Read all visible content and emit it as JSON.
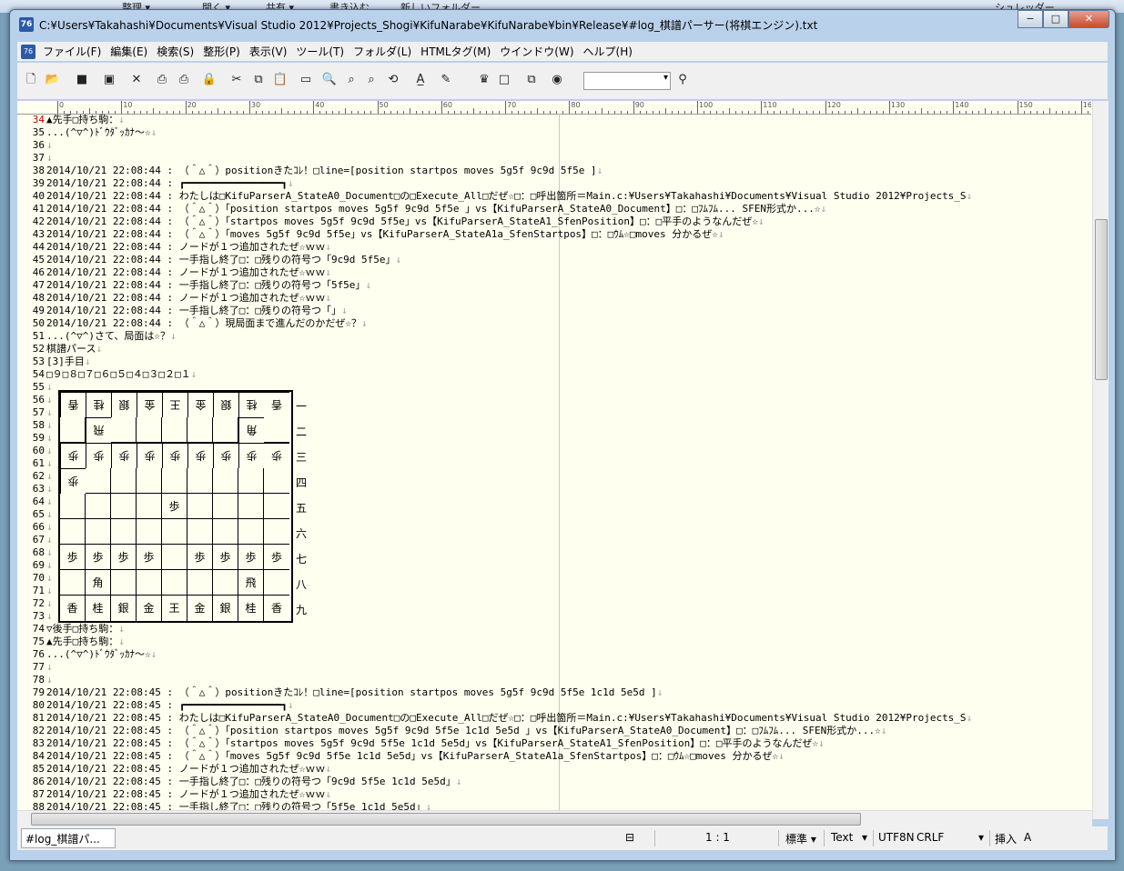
{
  "explorer": {
    "organize": "整理 ▾",
    "open": "開く ▾",
    "share": "共有 ▾",
    "write": "書き込む",
    "newfolder": "新しいフォルダー",
    "shredder": "シュレッダー"
  },
  "window": {
    "title": "C:¥Users¥Takahashi¥Documents¥Visual Studio 2012¥Projects_Shogi¥KifuNarabe¥KifuNarabe¥bin¥Release¥#log_棋譜パーサー(将棋エンジン).txt",
    "app_icon_label": "76",
    "minimize": "−",
    "maximize": "□",
    "close": "✕"
  },
  "menu": [
    "ファイル(F)",
    "編集(E)",
    "検索(S)",
    "整形(P)",
    "表示(V)",
    "ツール(T)",
    "フォルダ(L)",
    "HTMLタグ(M)",
    "ウインドウ(W)",
    "ヘルプ(H)"
  ],
  "toolbar": {
    "search_combo_value": ""
  },
  "ruler": [
    "0",
    "10",
    "20",
    "30",
    "40",
    "50",
    "60",
    "70",
    "80",
    "90",
    "100",
    "110",
    "120",
    "130",
    "140",
    "150",
    "160"
  ],
  "lines": [
    {
      "n": "34",
      "t": "▲先手□持ち駒："
    },
    {
      "n": "35",
      "t": "...(^▽^)ﾄﾞｳﾀﾞｯｶﾅ～☆"
    },
    {
      "n": "36",
      "t": ""
    },
    {
      "n": "37",
      "t": ""
    },
    {
      "n": "38",
      "t": "2014/10/21 22:08:44 : （＾△＾）positionきたｺﾚ！□line=[position startpos moves 5g5f 9c9d 5f5e ]"
    },
    {
      "n": "39",
      "t": "2014/10/21 22:08:44 : ┏━━━━━━━━━━━━━━━━┓"
    },
    {
      "n": "40",
      "t": "2014/10/21 22:08:44 : わたしは□KifuParserA_StateA0_Document□の□Execute_All□だぜ☆□：□呼出箇所＝Main.c:¥Users¥Takahashi¥Documents¥Visual Studio 2012¥Projects_S"
    },
    {
      "n": "41",
      "t": "2014/10/21 22:08:44 : （＾△＾）「position startpos moves 5g5f 9c9d 5f5e 」vs【KifuParserA_StateA0_Document】□：□ﾌﾑﾌﾑ... SFEN形式か...☆"
    },
    {
      "n": "42",
      "t": "2014/10/21 22:08:44 : （＾△＾）「startpos moves 5g5f 9c9d 5f5e」vs【KifuParserA_StateA1_SfenPosition】□：□平手のようなんだぜ☆"
    },
    {
      "n": "43",
      "t": "2014/10/21 22:08:44 : （＾△＾）「moves 5g5f 9c9d 5f5e」vs【KifuParserA_StateA1a_SfenStartpos】□：□ｳﾑ☆□moves 分かるぜ☆"
    },
    {
      "n": "44",
      "t": "2014/10/21 22:08:44 : ノードが１つ追加されたぜ☆ｗｗ"
    },
    {
      "n": "45",
      "t": "2014/10/21 22:08:44 : 一手指し終了□：□残りの符号つ「9c9d 5f5e」"
    },
    {
      "n": "46",
      "t": "2014/10/21 22:08:44 : ノードが１つ追加されたぜ☆ｗｗ"
    },
    {
      "n": "47",
      "t": "2014/10/21 22:08:44 : 一手指し終了□：□残りの符号つ「5f5e」"
    },
    {
      "n": "48",
      "t": "2014/10/21 22:08:44 : ノードが１つ追加されたぜ☆ｗｗ"
    },
    {
      "n": "49",
      "t": "2014/10/21 22:08:44 : 一手指し終了□：□残りの符号つ「」"
    },
    {
      "n": "50",
      "t": "2014/10/21 22:08:44 : （＾△＾）現局面まで進んだのかだぜ☆？"
    },
    {
      "n": "51",
      "t": "...(^▽^)さて、局面は☆？"
    },
    {
      "n": "52",
      "t": "棋譜パース"
    },
    {
      "n": "53",
      "t": "[3]手目"
    },
    {
      "n": "54",
      "t": "□９□８□７□６□５□４□３□２□１"
    },
    {
      "n": "55",
      "t": ""
    },
    {
      "n": "56",
      "t": ""
    },
    {
      "n": "57",
      "t": ""
    },
    {
      "n": "58",
      "t": ""
    },
    {
      "n": "59",
      "t": ""
    },
    {
      "n": "60",
      "t": ""
    },
    {
      "n": "61",
      "t": ""
    },
    {
      "n": "62",
      "t": ""
    },
    {
      "n": "63",
      "t": ""
    },
    {
      "n": "64",
      "t": ""
    },
    {
      "n": "65",
      "t": ""
    },
    {
      "n": "66",
      "t": ""
    },
    {
      "n": "67",
      "t": ""
    },
    {
      "n": "68",
      "t": ""
    },
    {
      "n": "69",
      "t": ""
    },
    {
      "n": "70",
      "t": ""
    },
    {
      "n": "71",
      "t": ""
    },
    {
      "n": "72",
      "t": ""
    },
    {
      "n": "73",
      "t": ""
    },
    {
      "n": "74",
      "t": "▽後手□持ち駒："
    },
    {
      "n": "75",
      "t": "▲先手□持ち駒："
    },
    {
      "n": "76",
      "t": "...(^▽^)ﾄﾞｳﾀﾞｯｶﾅ～☆"
    },
    {
      "n": "77",
      "t": ""
    },
    {
      "n": "78",
      "t": ""
    },
    {
      "n": "79",
      "t": "2014/10/21 22:08:45 : （＾△＾）positionきたｺﾚ！□line=[position startpos moves 5g5f 9c9d 5f5e 1c1d 5e5d ]"
    },
    {
      "n": "80",
      "t": "2014/10/21 22:08:45 : ┏━━━━━━━━━━━━━━━━┓"
    },
    {
      "n": "81",
      "t": "2014/10/21 22:08:45 : わたしは□KifuParserA_StateA0_Document□の□Execute_All□だぜ☆□：□呼出箇所＝Main.c:¥Users¥Takahashi¥Documents¥Visual Studio 2012¥Projects_S"
    },
    {
      "n": "82",
      "t": "2014/10/21 22:08:45 : （＾△＾）「position startpos moves 5g5f 9c9d 5f5e 1c1d 5e5d 」vs【KifuParserA_StateA0_Document】□：□ﾌﾑﾌﾑ... SFEN形式か...☆"
    },
    {
      "n": "83",
      "t": "2014/10/21 22:08:45 : （＾△＾）「startpos moves 5g5f 9c9d 5f5e 1c1d 5e5d」vs【KifuParserA_StateA1_SfenPosition】□：□平手のようなんだぜ☆"
    },
    {
      "n": "84",
      "t": "2014/10/21 22:08:45 : （＾△＾）「moves 5g5f 9c9d 5f5e 1c1d 5e5d」vs【KifuParserA_StateA1a_SfenStartpos】□：□ｳﾑ☆□moves 分かるぜ☆"
    },
    {
      "n": "85",
      "t": "2014/10/21 22:08:45 : ノードが１つ追加されたぜ☆ｗｗ"
    },
    {
      "n": "86",
      "t": "2014/10/21 22:08:45 : 一手指し終了□：□残りの符号つ「9c9d 5f5e 1c1d 5e5d」"
    },
    {
      "n": "87",
      "t": "2014/10/21 22:08:45 : ノードが１つ追加されたぜ☆ｗｗ"
    },
    {
      "n": "88",
      "t": "2014/10/21 22:08:45 : 一手指し終了□：□残りの符号つ「5f5e 1c1d 5e5d」"
    }
  ],
  "board": {
    "rows": [
      [
        "香",
        "桂",
        "銀",
        "金",
        "王",
        "金",
        "銀",
        "桂",
        "香"
      ],
      [
        "",
        "飛",
        "",
        "",
        "",
        "",
        "",
        "角",
        ""
      ],
      [
        "歩",
        "歩",
        "歩",
        "歩",
        "歩",
        "歩",
        "歩",
        "歩",
        "歩"
      ],
      [
        "歩",
        "",
        "",
        "",
        "",
        "",
        "",
        "",
        ""
      ],
      [
        "",
        "",
        "",
        "",
        "歩",
        "",
        "",
        "",
        ""
      ],
      [
        "",
        "",
        "",
        "",
        "",
        "",
        "",
        "",
        ""
      ],
      [
        "歩",
        "歩",
        "歩",
        "歩",
        "",
        "歩",
        "歩",
        "歩",
        "歩"
      ],
      [
        "",
        "角",
        "",
        "",
        "",
        "",
        "",
        "飛",
        ""
      ],
      [
        "香",
        "桂",
        "銀",
        "金",
        "王",
        "金",
        "銀",
        "桂",
        "香"
      ]
    ],
    "inverted_rows": [
      true,
      true,
      true,
      true,
      false,
      false,
      false,
      false,
      false
    ],
    "rank_labels": [
      "一",
      "二",
      "三",
      "四",
      "五",
      "六",
      "七",
      "八",
      "九"
    ]
  },
  "status": {
    "tab": "#log_棋譜パ...",
    "position": "1 : 1",
    "mode": "標準 ▾",
    "filetype": "Text",
    "encoding": "UTF8N",
    "newline": "CRLF",
    "insert": "挿入",
    "input": "A"
  }
}
